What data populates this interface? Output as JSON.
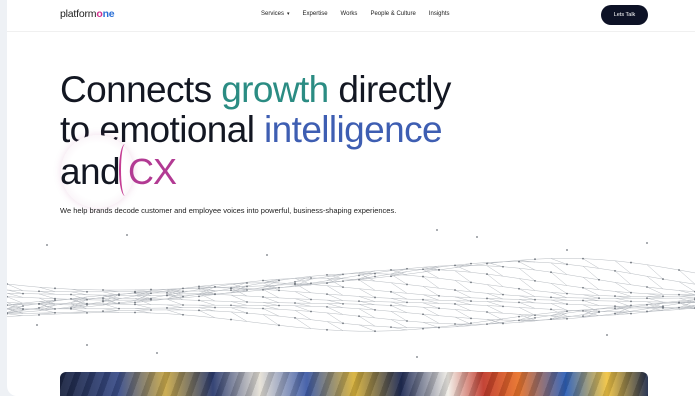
{
  "logo": {
    "part1": "platform",
    "part2_o": "o",
    "part2_rest": "ne"
  },
  "nav": {
    "items": [
      {
        "label": "Services",
        "caret": "▾"
      },
      {
        "label": "Expertise"
      },
      {
        "label": "Works"
      },
      {
        "label": "People & Culture"
      },
      {
        "label": "Insights"
      }
    ],
    "cta": "Lets Talk"
  },
  "hero": {
    "line1_a": "Connects ",
    "line1_b": "growth",
    "line1_c": " directly",
    "line2_a": "to emotional ",
    "line2_b": "intelligence",
    "line3_a": "and",
    "line3_b": "CX",
    "subtitle": "We help brands decode customer and employee voices into powerful, business-shaping experiences."
  },
  "colors": {
    "accent_teal": "#2b8c83",
    "accent_blue": "#3e5eb2",
    "accent_magenta": "#b23a93",
    "cta_bg": "#0d1226"
  }
}
